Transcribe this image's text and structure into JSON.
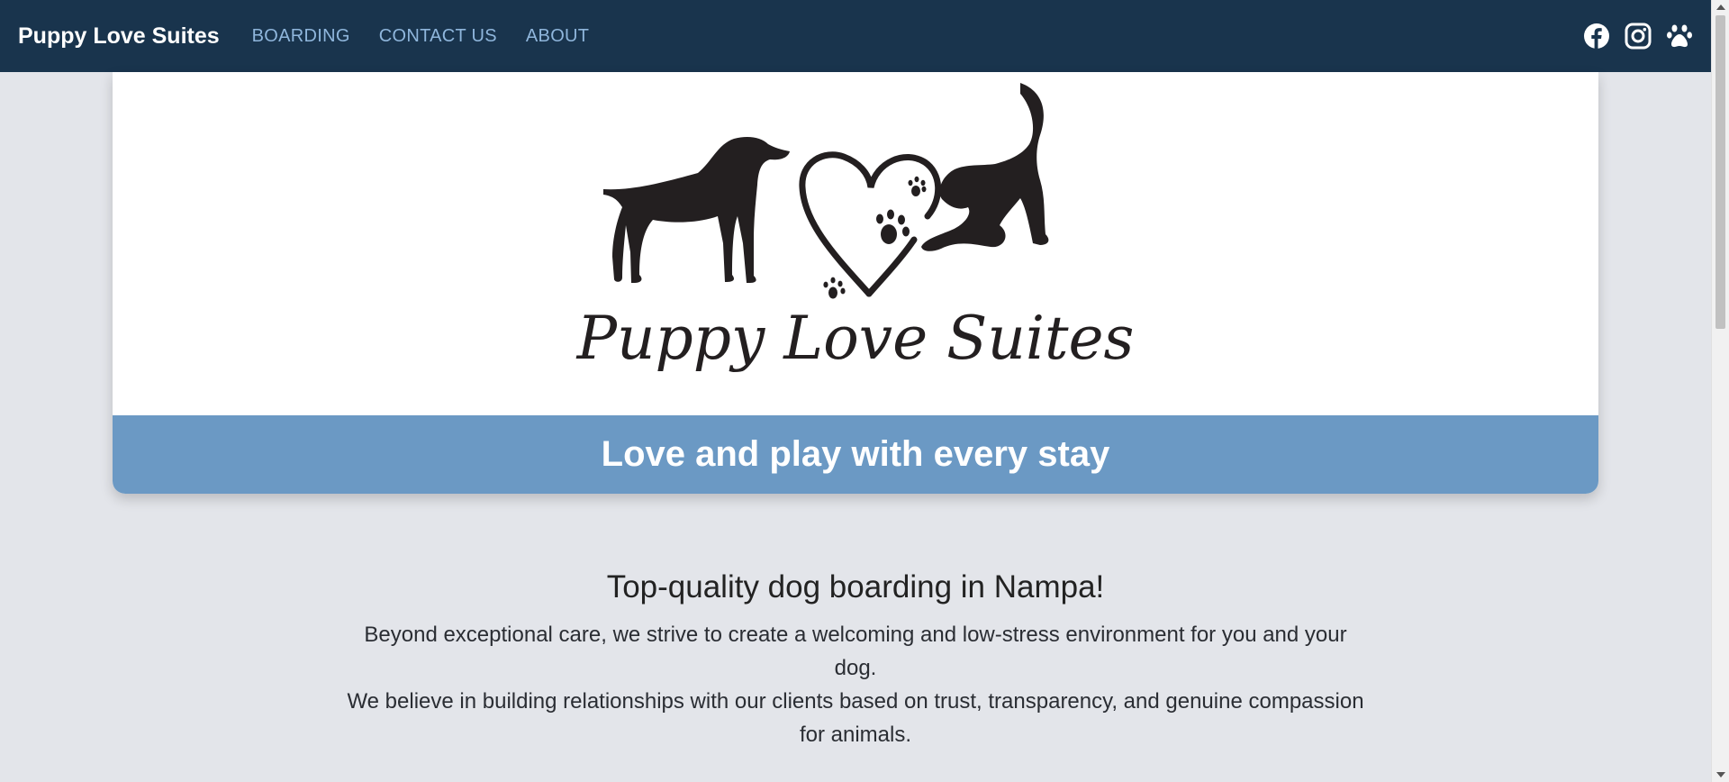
{
  "nav": {
    "brand": "Puppy Love Suites",
    "links": [
      "BOARDING",
      "CONTACT US",
      "ABOUT"
    ],
    "icons": [
      "facebook-icon",
      "instagram-icon",
      "paw-icon"
    ]
  },
  "hero": {
    "logo_text": "Puppy Love Suites",
    "tagline": "Love and play with every stay"
  },
  "intro": {
    "heading": "Top-quality dog boarding in Nampa!",
    "paragraph1": "Beyond exceptional care, we strive to create a welcoming and low-stress environment for you and your dog.",
    "paragraph2": "We believe in building relationships with our clients based on trust, transparency, and genuine compassion for animals."
  },
  "colors": {
    "navbar": "#19344d",
    "nav_link": "#8fb6dc",
    "banner": "#6b99c4",
    "page_bg": "#e3e5ea"
  }
}
